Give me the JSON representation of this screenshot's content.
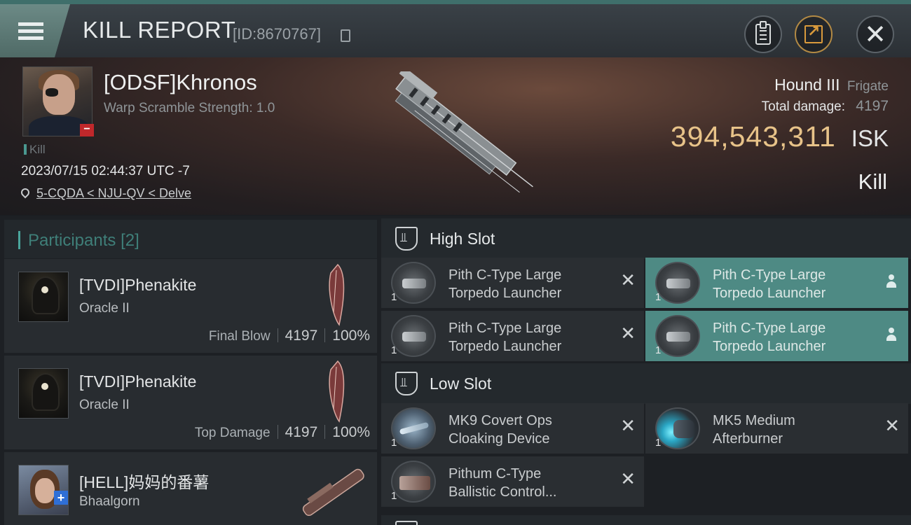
{
  "header": {
    "title": "KILL REPORT",
    "report_id": "[ID:8670767]",
    "icons": [
      "menu-icon",
      "copy-icon",
      "clipboard-icon",
      "share-icon",
      "close-icon"
    ]
  },
  "victim": {
    "name": "[ODSF]Khronos",
    "warp_scramble": "Warp Scramble Strength: 1.0",
    "kill_tag": "Kill",
    "datetime": "2023/07/15 02:44:37 UTC -7",
    "location": "5-CQDA < NJU-QV < Delve",
    "ship_name": "Hound III",
    "ship_class": "Frigate",
    "total_damage_label": "Total damage:",
    "total_damage": "4197",
    "isk_value": "394,543,311",
    "isk_unit": "ISK",
    "result": "Kill"
  },
  "participants": {
    "title": "Participants",
    "count": "[2]",
    "list": [
      {
        "name": "[TVDI]Phenakite",
        "ship": "Oracle II",
        "role": "Final Blow",
        "damage": "4197",
        "percent": "100%"
      },
      {
        "name": "[TVDI]Phenakite",
        "ship": "Oracle II",
        "role": "Top Damage",
        "damage": "4197",
        "percent": "100%"
      },
      {
        "name": "[HELL]妈妈的番薯",
        "ship": "Bhaalgorn"
      }
    ]
  },
  "slots": {
    "high": {
      "title": "High Slot",
      "items": [
        {
          "qty": "1",
          "name_line1": "Pith C-Type Large",
          "name_line2": "Torpedo Launcher",
          "state": "destroyed"
        },
        {
          "qty": "1",
          "name_line1": "Pith C-Type Large",
          "name_line2": "Torpedo Launcher",
          "state": "dropped"
        },
        {
          "qty": "1",
          "name_line1": "Pith C-Type Large",
          "name_line2": "Torpedo Launcher",
          "state": "destroyed"
        },
        {
          "qty": "1",
          "name_line1": "Pith C-Type Large",
          "name_line2": "Torpedo Launcher",
          "state": "dropped"
        }
      ]
    },
    "low": {
      "title": "Low Slot",
      "items": [
        {
          "qty": "1",
          "name_line1": "MK9 Covert Ops",
          "name_line2": "Cloaking Device",
          "state": "destroyed"
        },
        {
          "qty": "1",
          "name_line1": "MK5 Medium",
          "name_line2": "Afterburner",
          "state": "destroyed"
        },
        {
          "qty": "1",
          "name_line1": "Pithum C-Type",
          "name_line2": "Ballistic Control...",
          "state": "destroyed"
        }
      ]
    }
  },
  "colors": {
    "accent_teal": "#4e8a84",
    "isk_gold": "#e8c389",
    "danger_red": "#c0282b",
    "plus_blue": "#2f6fd6"
  }
}
